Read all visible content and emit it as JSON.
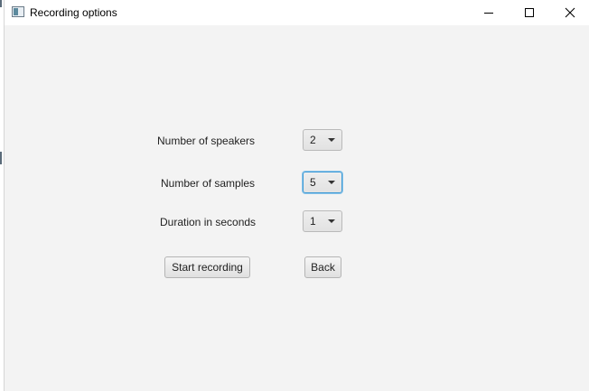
{
  "window": {
    "title": "Recording options",
    "controls": {
      "minimize": "minimize-icon",
      "maximize": "maximize-icon",
      "close": "close-icon"
    }
  },
  "form": {
    "speakers": {
      "label": "Number of speakers",
      "value": "2"
    },
    "samples": {
      "label": "Number of samples",
      "value": "5"
    },
    "duration": {
      "label": "Duration in seconds",
      "value": "1"
    }
  },
  "buttons": {
    "start": "Start recording",
    "back": "Back"
  },
  "colors": {
    "background": "#f3f3f3",
    "focus": "#3c9ad6"
  }
}
